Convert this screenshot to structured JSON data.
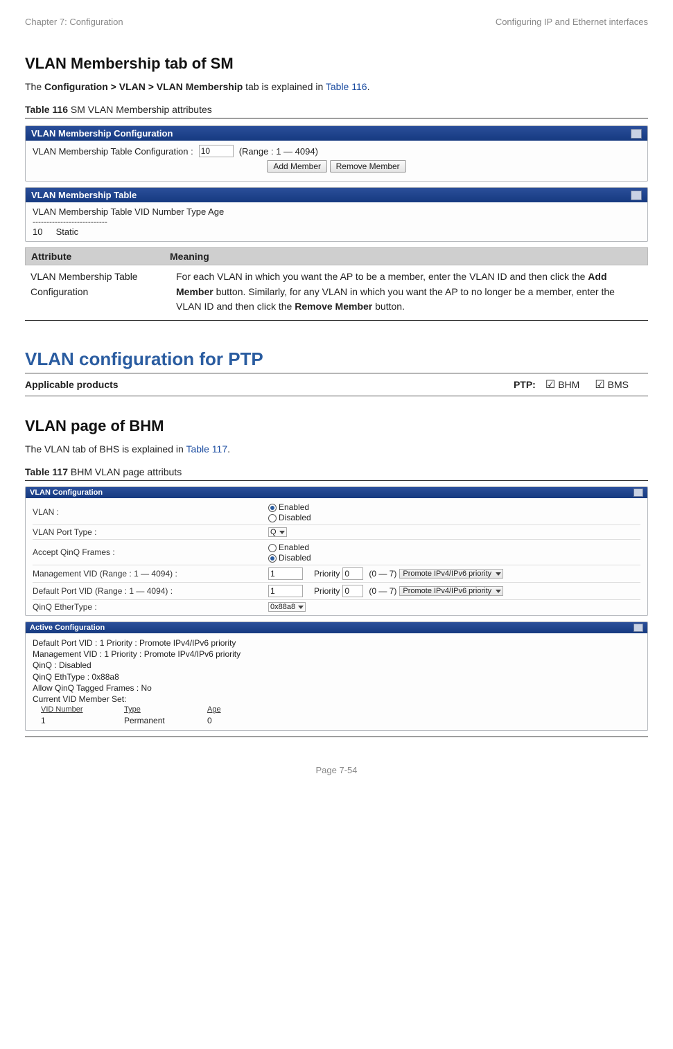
{
  "header": {
    "left": "Chapter 7:  Configuration",
    "right": "Configuring IP and Ethernet interfaces"
  },
  "section1": {
    "title": "VLAN Membership tab of SM",
    "intro_prefix": "The ",
    "intro_bold": "Configuration > VLAN > VLAN Membership",
    "intro_suffix": " tab is explained in ",
    "intro_link": "Table 116",
    "intro_end": ".",
    "table_caption_bold": "Table 116",
    "table_caption_rest": " SM VLAN Membership attributes"
  },
  "panel_membership_config": {
    "title": "VLAN Membership Configuration",
    "rowLabel": "VLAN Membership Table Configuration :",
    "value": "10",
    "range": "(Range : 1 — 4094)",
    "btnAdd": "Add Member",
    "btnRemove": "Remove Member"
  },
  "panel_membership_table": {
    "title": "VLAN Membership Table",
    "headerRow": "VLAN Membership Table VID Number   Type   Age",
    "divider": "---------------------------",
    "row1_vid": "10",
    "row1_type": "Static"
  },
  "attr_table": {
    "h1": "Attribute",
    "h2": "Meaning",
    "row1_attr": "VLAN Membership Table Configuration",
    "row1_meaning_pre": "For each VLAN in which you want the AP to be a member, enter the VLAN ID and then click the ",
    "row1_meaning_b1": "Add Member",
    "row1_meaning_mid": " button. Similarly, for any VLAN in which you want the AP to no longer be a member, enter the VLAN ID and then click the ",
    "row1_meaning_b2": "Remove Member",
    "row1_meaning_post": " button."
  },
  "section2": {
    "title": "VLAN configuration for PTP",
    "applicable_label": "Applicable products",
    "ptp_label": "PTP:",
    "bhm": "BHM",
    "bms": "BMS"
  },
  "section3": {
    "title": "VLAN page of BHM",
    "intro_pre": "The VLAN tab of BHS is explained in ",
    "intro_link": "Table 117",
    "intro_post": ".",
    "table_caption_bold": "Table 117",
    "table_caption_rest": " BHM VLAN page attributs"
  },
  "vlan_config": {
    "panel_title": "VLAN Configuration",
    "row_vlan_label": "VLAN :",
    "opt_enabled": "Enabled",
    "opt_disabled": "Disabled",
    "row_port_type_label": "VLAN Port Type :",
    "port_type_value": "Q",
    "row_qinq_frames_label": "Accept QinQ Frames :",
    "row_mgmt_vid_label": "Management VID (Range : 1 — 4094) :",
    "mgmt_vid_value": "1",
    "priority_label": "Priority",
    "priority_value": "0",
    "priority_range": "(0 — 7)",
    "priority_select": "Promote IPv4/IPv6 priority",
    "row_default_vid_label": "Default Port VID (Range : 1 — 4094) :",
    "default_vid_value": "1",
    "row_qinq_ether_label": "QinQ EtherType :",
    "qinq_ether_value": "0x88a8"
  },
  "active_config": {
    "panel_title": "Active Configuration",
    "line1": "Default Port VID : 1    Priority : Promote IPv4/IPv6 priority",
    "line2": "Management VID : 1    Priority : Promote IPv4/IPv6 priority",
    "line3": "QinQ : Disabled",
    "line4": "QinQ EthType : 0x88a8",
    "line5": "Allow QinQ Tagged Frames : No",
    "line6": "Current VID Member Set:",
    "col_h1": "VID Number",
    "col_h2": "Type",
    "col_h3": "Age",
    "row_v1": "1",
    "row_v2": "Permanent",
    "row_v3": "0"
  },
  "footer": "Page 7-54"
}
